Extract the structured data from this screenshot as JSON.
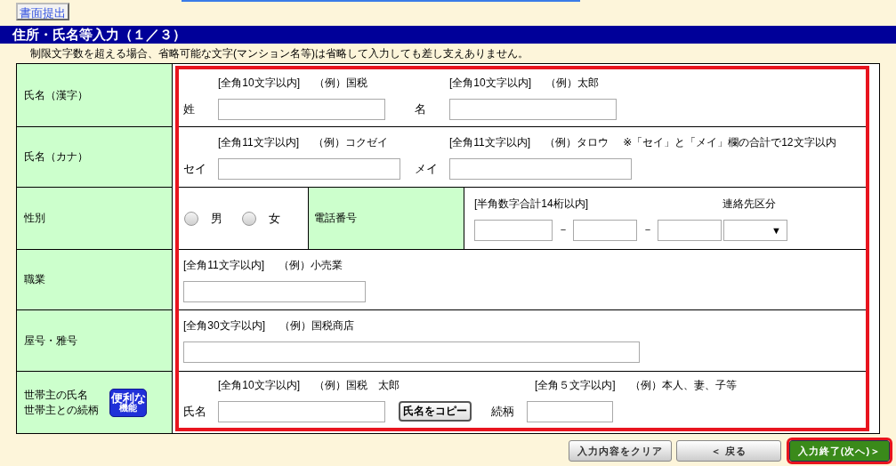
{
  "top_button": "書面提出",
  "section_title": "住所・氏名等入力（１／３）",
  "notice": "制限文字数を超える場合、省略可能な文字(マンション名等)は省略して入力しても差し支えありません。",
  "rows": [
    {
      "kind": "pair",
      "label": "氏名（漢字）",
      "fields": [
        {
          "prefix": "姓",
          "limit": "[全角10文字以内]",
          "example": "（例）国税"
        },
        {
          "prefix": "名",
          "limit": "[全角10文字以内]",
          "example": "（例）太郎"
        }
      ]
    },
    {
      "kind": "pair",
      "label": "氏名（カナ）",
      "fields": [
        {
          "prefix": "セイ",
          "limit": "[全角11文字以内]",
          "example": "（例）コクゼイ"
        },
        {
          "prefix": "メイ",
          "limit": "[全角11文字以内]",
          "example": "（例）タロウ"
        }
      ],
      "note": "※「セイ」と「メイ」欄の合計で12文字以内"
    },
    {
      "kind": "gender",
      "label": "性別",
      "options": [
        {
          "label": "男",
          "selected": false
        },
        {
          "label": "女",
          "selected": false
        }
      ],
      "phone_label": "電話番号",
      "phone_limit": "[半角数字合計14桁以内]",
      "separators": [
        "－",
        "－"
      ],
      "contact_label": "連絡先区分",
      "contact_caret": "▼"
    },
    {
      "kind": "short_text",
      "label": "職業",
      "limit": "[全角11文字以内]",
      "example": "（例）小売業"
    },
    {
      "kind": "long_text",
      "label": "屋号・雅号",
      "limit": "[全角30文字以内]",
      "example": "（例）国税商店"
    },
    {
      "kind": "householder",
      "label_lines": [
        "世帯主の氏名",
        "世帯主との続柄"
      ],
      "badge_lines": [
        "便利な",
        "機能"
      ],
      "name_prefix": "氏名",
      "name_limit": "[全角10文字以内]",
      "name_example": "（例）国税　太郎",
      "copy_button": "氏名をコピー",
      "relation_prefix": "続柄",
      "relation_limit": "[全角５文字以内]",
      "relation_example": "（例）本人、妻、子等"
    }
  ],
  "buttons": [
    {
      "kind": "plain",
      "label": "入力内容をクリア"
    },
    {
      "kind": "plain",
      "label": "＜ 戻る"
    },
    {
      "kind": "primary",
      "label": "入力終了(次へ)＞"
    }
  ]
}
